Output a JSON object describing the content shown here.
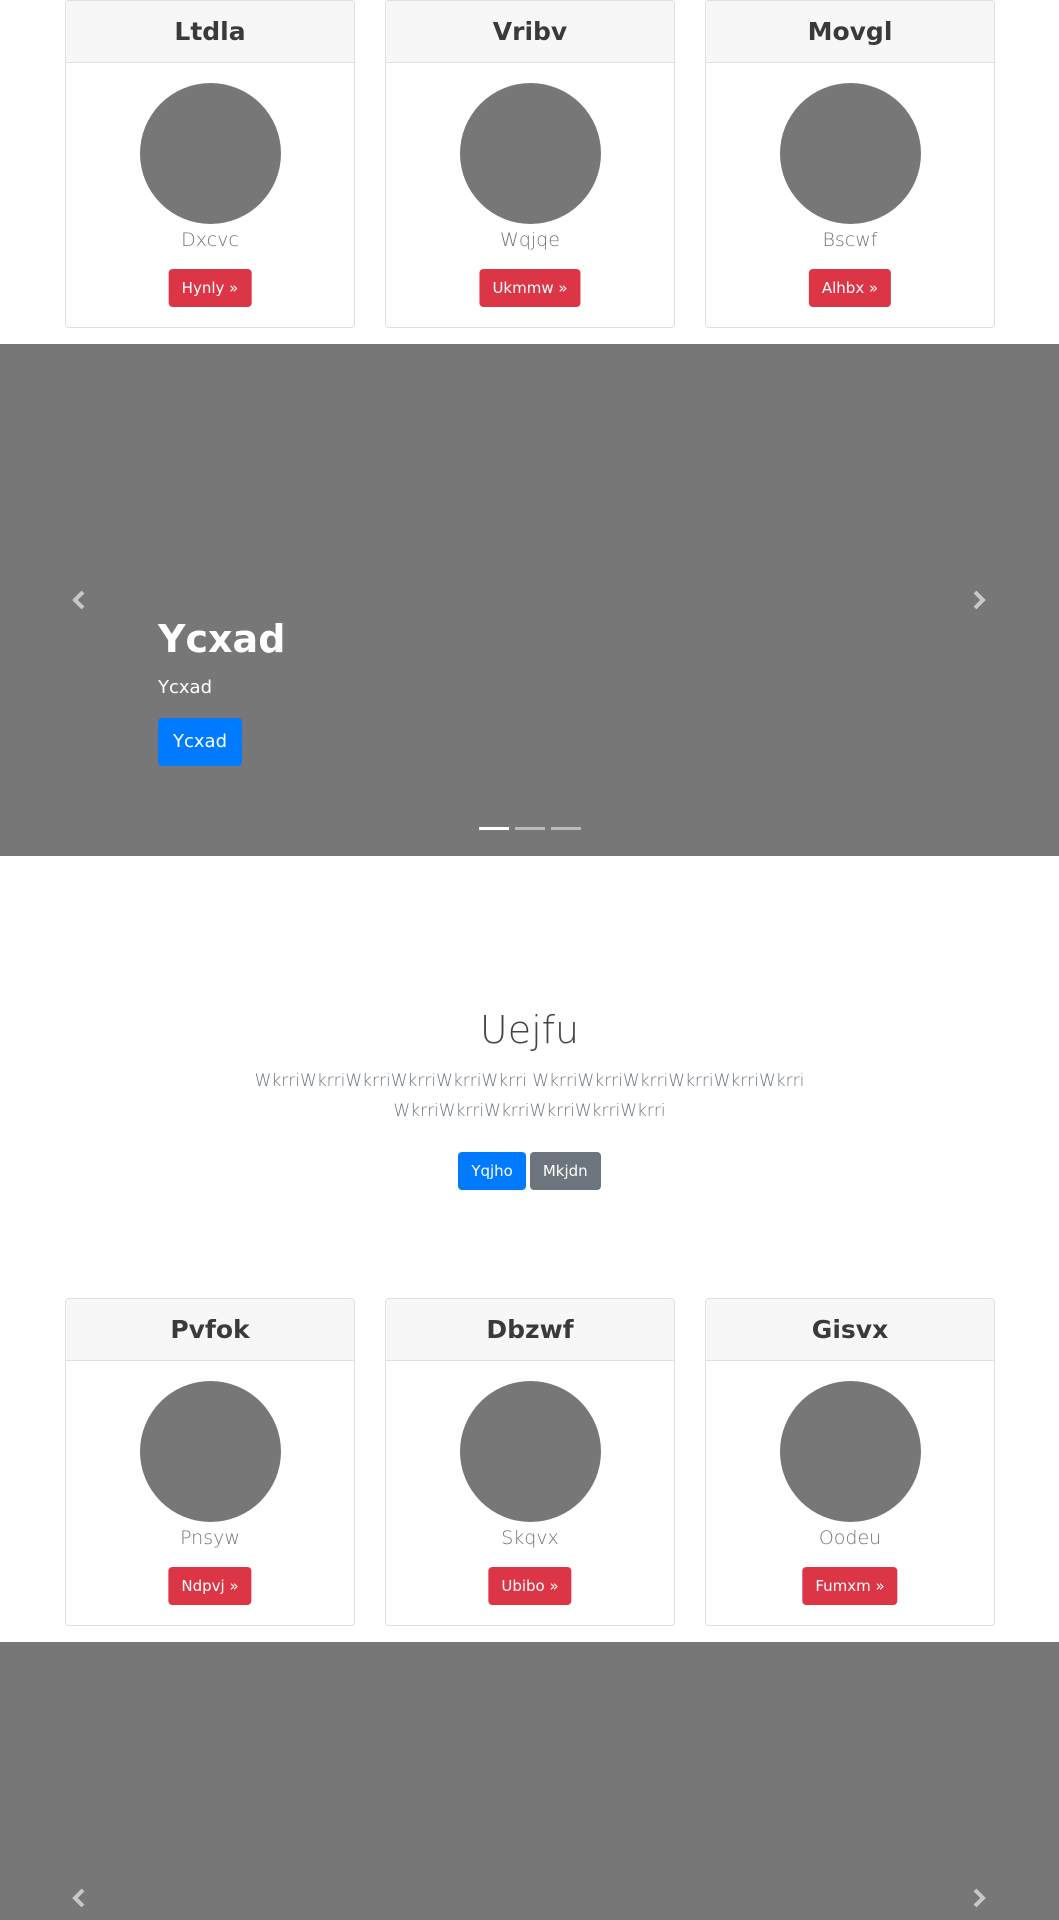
{
  "cards_top": [
    {
      "title": "Ltdla",
      "name": "Dxcvc",
      "button": "Hynly »"
    },
    {
      "title": "Vribv",
      "name": "Wqjqe",
      "button": "Ukmmw »"
    },
    {
      "title": "Movgl",
      "name": "Bscwf",
      "button": "Alhbx »"
    }
  ],
  "carousel_1": {
    "heading": "Ycxad",
    "text": "Ycxad",
    "button": "Ycxad",
    "prev_icon": "chevron-left-icon",
    "next_icon": "chevron-right-icon",
    "indicator_count": 3,
    "active_indicator": 0
  },
  "hero": {
    "title": "Uejfu",
    "text": "WkrriWkrriWkrriWkrriWkrriWkrri WkrriWkrriWkrriWkrriWkrriWkrri WkrriWkrriWkrriWkrriWkrriWkrri",
    "primary_button": "Yqjho",
    "secondary_button": "Mkjdn"
  },
  "cards_bottom": [
    {
      "title": "Pvfok",
      "name": "Pnsyw",
      "button": "Ndpvj »"
    },
    {
      "title": "Dbzwf",
      "name": "Skqvx",
      "button": "Ubibo »"
    },
    {
      "title": "Gisvx",
      "name": "Oodeu",
      "button": "Fumxm »"
    }
  ],
  "carousel_2": {
    "prev_icon": "chevron-left-icon",
    "next_icon": "chevron-right-icon"
  },
  "colors": {
    "card_button": "#dc3545",
    "primary": "#007bff",
    "secondary": "#6c757d",
    "carousel_bg": "#777777",
    "avatar": "#777777"
  }
}
